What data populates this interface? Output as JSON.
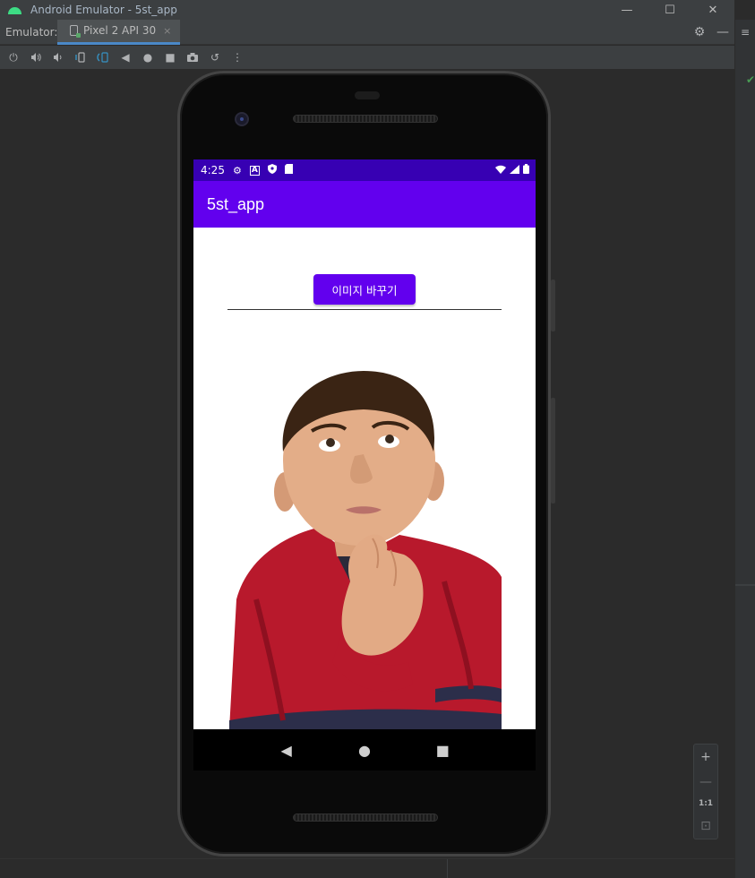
{
  "window": {
    "title": "Android Emulator - 5st_app",
    "minimize": "—",
    "maximize": "☐",
    "close": "✕"
  },
  "tabbar": {
    "label": "Emulator:",
    "tab_label": "Pixel 2 API 30",
    "tab_close": "×",
    "settings_icon": "⚙",
    "hide_icon": "—"
  },
  "toolbar": {
    "power": "⏻",
    "volume_up": "🔊",
    "volume_down": "🔉",
    "rotate_left": "⟲",
    "rotate_right": "⟳",
    "back": "◀",
    "home": "●",
    "overview": "■",
    "screenshot": "📷",
    "snapshot": "↺",
    "more": "⋮"
  },
  "status_bar": {
    "time": "4:25",
    "icons": [
      "gear-icon",
      "a-icon",
      "shield-icon",
      "sd-card-icon"
    ],
    "right_icons": [
      "wifi-icon",
      "signal-icon",
      "battery-icon"
    ]
  },
  "app": {
    "title": "5st_app",
    "button_label": "이미지 바꾸기"
  },
  "navbar": {
    "back": "◀",
    "home": "●",
    "recents": "■"
  },
  "zoom": {
    "zoom_in": "+",
    "zoom_out": "—",
    "one_to_one": "1:1",
    "fit": "⊡"
  },
  "colors": {
    "status_bar": "#3700b3",
    "app_bar": "#6200ee",
    "button": "#6200ee",
    "ide_background": "#2b2b2b"
  }
}
